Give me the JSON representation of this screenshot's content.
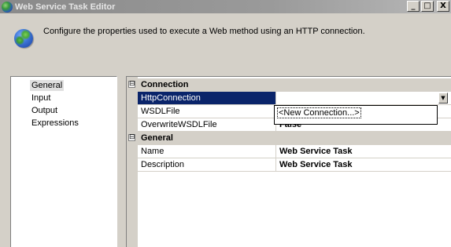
{
  "window": {
    "title": "Web Service Task Editor",
    "minimize_glyph": "_",
    "maximize_glyph": "□",
    "close_glyph": "X"
  },
  "header": {
    "description": "Configure the properties used to execute a Web method using an HTTP connection."
  },
  "nav": {
    "items": [
      "General",
      "Input",
      "Output",
      "Expressions"
    ],
    "selected": "General"
  },
  "grid": {
    "categories": [
      {
        "label": "Connection",
        "toggle": "⊟",
        "properties": [
          {
            "name": "HttpConnection",
            "value": ""
          },
          {
            "name": "WSDLFile",
            "value": ""
          },
          {
            "name": "OverwriteWSDLFile",
            "value": "False"
          }
        ]
      },
      {
        "label": "General",
        "toggle": "⊟",
        "properties": [
          {
            "name": "Name",
            "value": "Web Service Task"
          },
          {
            "name": "Description",
            "value": "Web Service Task"
          }
        ]
      }
    ],
    "dropdown": {
      "arrow_glyph": "▼",
      "options": [
        "<New Connection...>"
      ]
    }
  },
  "colors": {
    "selection": "#0a246a",
    "face": "#d4d0c8"
  }
}
